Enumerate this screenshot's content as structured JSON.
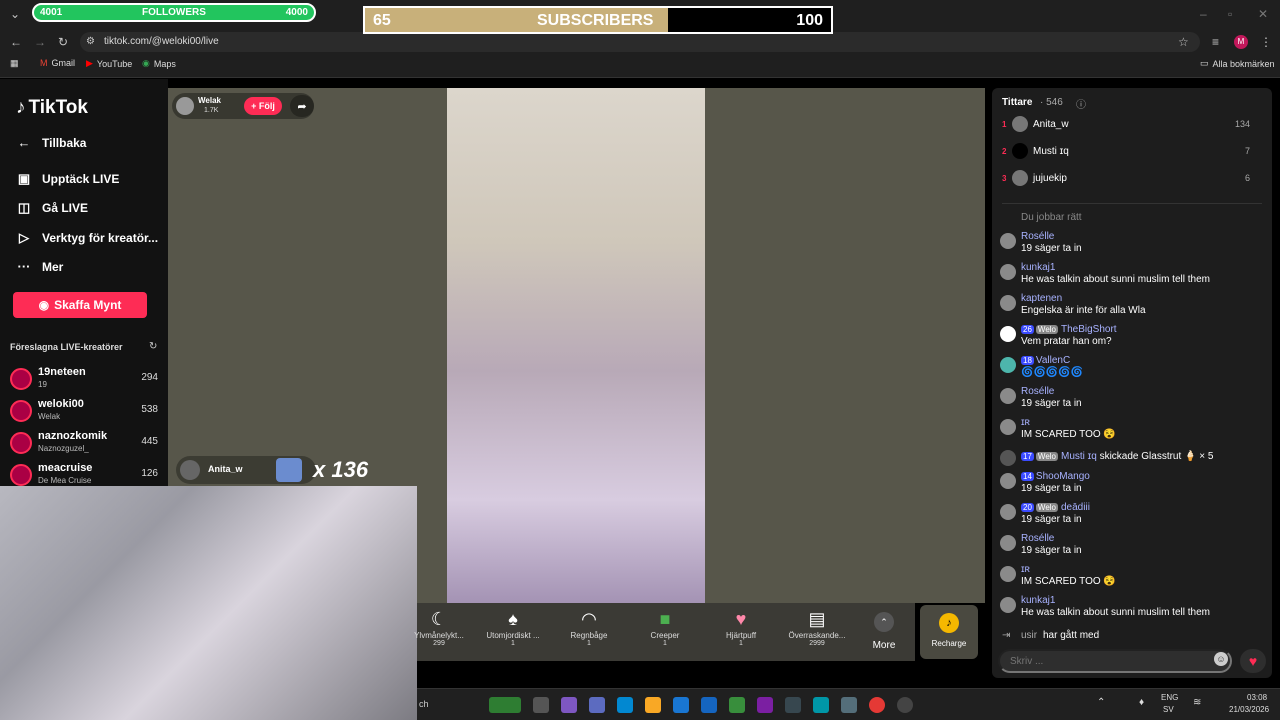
{
  "overlay": {
    "followers_current": "4001",
    "followers_label": "FOLLOWERS",
    "followers_goal": "4000",
    "subs_current": "65",
    "subs_label": "SUBSCRIBERS",
    "subs_goal": "100",
    "subs_progress": 0.65
  },
  "browser": {
    "url": "tiktok.com/@weloki00/live",
    "bookmarks": [
      "Gmail",
      "YouTube",
      "Maps"
    ],
    "all_bookmarks": "Alla bokmärken",
    "profile_letter": "M"
  },
  "sidebar": {
    "logo": "TikTok",
    "back": "Tillbaka",
    "nav": [
      "Upptäck LIVE",
      "Gå LIVE",
      "Verktyg för kreatör...",
      "Mer"
    ],
    "coin_button": "Skaffa Mynt",
    "suggested_title": "Föreslagna LIVE-kreatörer",
    "creators": [
      {
        "name": "19neteen",
        "sub": "19",
        "count": "294"
      },
      {
        "name": "weloki00",
        "sub": "Welak",
        "count": "538"
      },
      {
        "name": "naznozkomik",
        "sub": "Naznozguzel_",
        "count": "445"
      },
      {
        "name": "meacruise",
        "sub": "De Mea Cruise",
        "count": "126"
      }
    ]
  },
  "stream": {
    "host_name": "Welak",
    "host_likes": "1.7K",
    "follow_label": "+ Följ",
    "gift_sender": "Anita_w",
    "combo": "x 136"
  },
  "gifts": [
    {
      "name": "Ylvmånelykt...",
      "price": "299"
    },
    {
      "name": "Utomjordiskt ...",
      "price": "1"
    },
    {
      "name": "Regnbåge",
      "price": "1"
    },
    {
      "name": "Creeper",
      "price": "1"
    },
    {
      "name": "Hjärtpuff",
      "price": "1"
    },
    {
      "name": "Överraskande...",
      "price": "2999"
    }
  ],
  "gifts_more": "More",
  "recharge": "Recharge",
  "viewers": {
    "title": "Tittare",
    "count": "· 546",
    "top": [
      {
        "rank": "1",
        "name": "Anita_w",
        "score": "134"
      },
      {
        "rank": "2",
        "name": "Musti ɪq",
        "score": "7"
      },
      {
        "rank": "3",
        "name": "jujuekip",
        "score": "6"
      }
    ]
  },
  "chat": [
    {
      "user": "Du jobbar rätt",
      "text": ""
    },
    {
      "user": "Rosélle",
      "text": "19 säger ta in"
    },
    {
      "user": "kunkaj1",
      "text": "He was talkin about sunni muslim tell them"
    },
    {
      "user": "kaptenen",
      "text": "Engelska är inte för alla Wla"
    },
    {
      "user": "TheBigShort",
      "lvl": "26",
      "fan": "Welo",
      "text": "Vem pratar han om?"
    },
    {
      "user": "VallenC",
      "lvl": "18",
      "text": "🌀🌀🌀🌀🌀"
    },
    {
      "user": "Rosélle",
      "text": "19 säger ta in"
    },
    {
      "user": "ɪʀ",
      "text": "IM SCARED TOO 😵"
    },
    {
      "user": "Musti ɪq",
      "lvl": "17",
      "fan": "Welo",
      "text": "skickade Glasstrut 🍦 × 5"
    },
    {
      "user": "ShooMango",
      "lvl": "14",
      "text": "19 säger ta in"
    },
    {
      "user": "deādiii",
      "lvl": "20",
      "fan": "Welo",
      "text": "19 säger ta in"
    },
    {
      "user": "Rosélle",
      "text": "19 säger ta in"
    },
    {
      "user": "ɪʀ",
      "text": "IM SCARED TOO 😵"
    },
    {
      "user": "kunkaj1",
      "text": "He was talkin about sunni muslim tell them"
    },
    {
      "user": "usir",
      "text": "har gått med"
    }
  ],
  "chat_input_placeholder": "Skriv ...",
  "taskbar": {
    "lang": "ENG",
    "region": "SV",
    "time": "03:08",
    "date": "21/03/2026",
    "search": "ch"
  }
}
